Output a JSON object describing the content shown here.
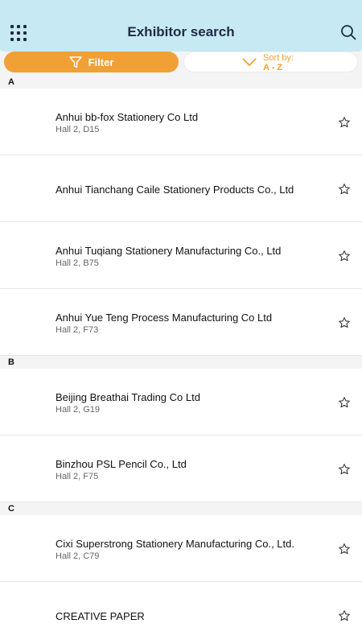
{
  "header": {
    "title": "Exhibitor search",
    "menu_icon": "grid-menu-icon",
    "search_icon": "search-icon",
    "background": "#c7e9f4"
  },
  "toolbar": {
    "filter_label": "Filter",
    "sort_label": "Sort by:",
    "sort_value": "A - Z",
    "accent": "#f0a035"
  },
  "sections": [
    {
      "letter": "A",
      "items": [
        {
          "name": "Anhui bb-fox Stationery Co Ltd",
          "location": "Hall 2, D15"
        },
        {
          "name": "Anhui Tianchang Caile Stationery Products Co., Ltd",
          "location": ""
        },
        {
          "name": "Anhui Tuqiang Stationery Manufacturing Co., Ltd",
          "location": "Hall 2, B75"
        },
        {
          "name": "Anhui Yue Teng Process Manufacturing Co Ltd",
          "location": "Hall 2, F73"
        }
      ]
    },
    {
      "letter": "B",
      "items": [
        {
          "name": "Beijing Breathai Trading Co Ltd",
          "location": "Hall 2, G19"
        },
        {
          "name": "Binzhou PSL Pencil Co., Ltd",
          "location": "Hall 2, F75"
        }
      ]
    },
    {
      "letter": "C",
      "items": [
        {
          "name": "Cixi Superstrong Stationery Manufacturing Co., Ltd.",
          "location": "Hall 2, C79"
        },
        {
          "name": "CREATIVE PAPER",
          "location": ""
        }
      ]
    }
  ]
}
